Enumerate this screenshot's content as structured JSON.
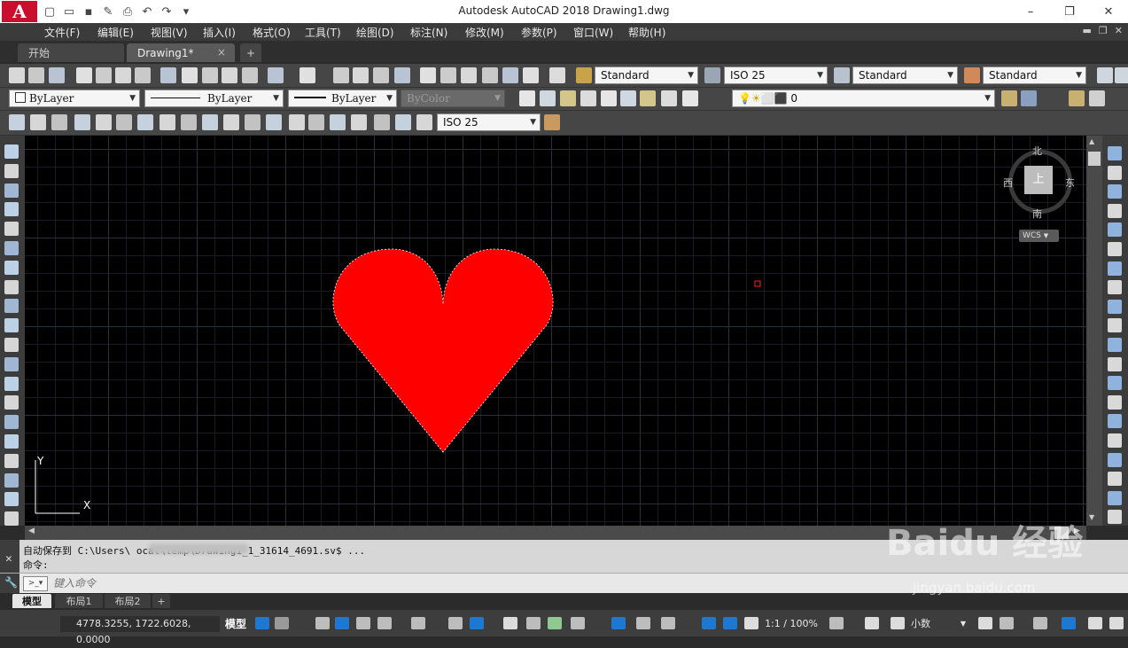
{
  "window": {
    "title": "Autodesk AutoCAD 2018    Drawing1.dwg",
    "logo_letter": "A"
  },
  "menu": [
    "文件(F)",
    "编辑(E)",
    "视图(V)",
    "插入(I)",
    "格式(O)",
    "工具(T)",
    "绘图(D)",
    "标注(N)",
    "修改(M)",
    "参数(P)",
    "窗口(W)",
    "帮助(H)"
  ],
  "tabs": {
    "start": "开始",
    "drawing": "Drawing1*",
    "close_glyph": "×",
    "add_glyph": "+"
  },
  "toolbar": {
    "text_style": "Standard",
    "dim_style": "ISO 25",
    "table_style": "Standard",
    "mleader_style": "Standard",
    "color": "ByLayer",
    "linetype": "ByLayer",
    "lineweight": "ByLayer",
    "plotstyle": "ByColor",
    "layer": "0",
    "dim_style_2": "ISO 25"
  },
  "viewcube": {
    "north": "北",
    "south": "南",
    "east": "东",
    "west": "西",
    "face": "上",
    "wcs": "WCS"
  },
  "ucs": {
    "y_label": "Y",
    "x_label": "X"
  },
  "command": {
    "history_line1": "自动保存到 C:\\Users\\            ocal\\temp\\Drawing1_1_31614_4691.sv$ ...",
    "history_line2": "命令:",
    "input_placeholder": "键入命令"
  },
  "layout_tabs": [
    "模型",
    "布局1",
    "布局2"
  ],
  "status": {
    "coords": "4778.3255, 1722.6028, 0.0000",
    "model_label": "模型",
    "scale": "1:1 / 100%",
    "units": "小数"
  },
  "colors": {
    "heart_fill": "#ff0000",
    "canvas_bg": "#000000",
    "accent_blue": "#1e78d2",
    "logo_red": "#c8102e"
  }
}
